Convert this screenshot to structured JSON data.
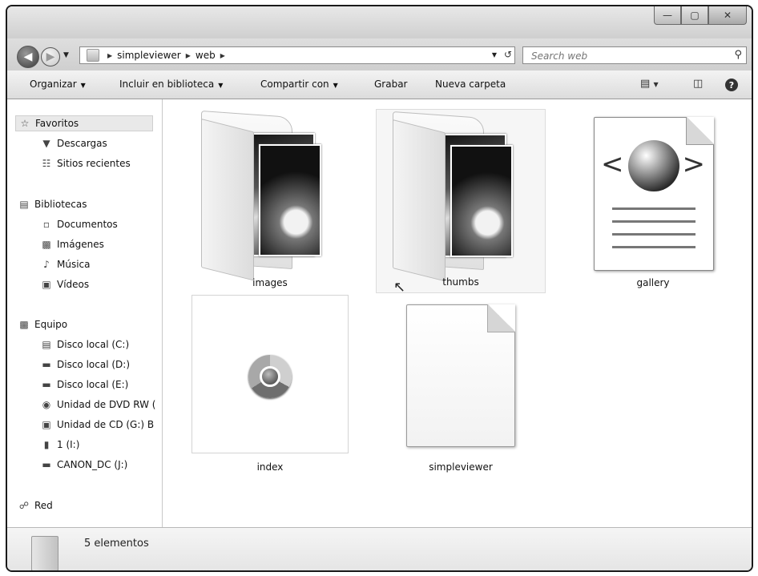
{
  "window": {
    "buttons": {
      "minimize": "—",
      "maximize": "▢",
      "close": "✕"
    }
  },
  "address": {
    "crumbs": [
      "simpleviewer",
      "web"
    ],
    "search_placeholder": "Search web"
  },
  "toolbar": {
    "organize": "Organizar",
    "include_library": "Incluir en biblioteca",
    "share": "Compartir con",
    "burn": "Grabar",
    "new_folder": "Nueva carpeta"
  },
  "nav": {
    "favorites": "Favoritos",
    "downloads": "Descargas",
    "recent": "Sitios recientes",
    "libraries": "Bibliotecas",
    "documents": "Documentos",
    "images": "Imágenes",
    "music": "Música",
    "videos": "Vídeos",
    "computer": "Equipo",
    "disk_c": "Disco local (C:)",
    "disk_d": "Disco local (D:)",
    "disk_e": "Disco local (E:)",
    "dvd": "Unidad de DVD RW (",
    "cd": "Unidad de CD (G:) B",
    "drive_i": "1 (I:)",
    "canon": "CANON_DC (J:)",
    "network": "Red"
  },
  "files": [
    {
      "name": "images",
      "type": "folder-icon"
    },
    {
      "name": "thumbs",
      "type": "folder-icon"
    },
    {
      "name": "gallery",
      "type": "xml-file-icon"
    },
    {
      "name": "index",
      "type": "chrome-html-icon"
    },
    {
      "name": "simpleviewer",
      "type": "blank-file-icon"
    }
  ],
  "status": {
    "count": "5 elementos"
  }
}
